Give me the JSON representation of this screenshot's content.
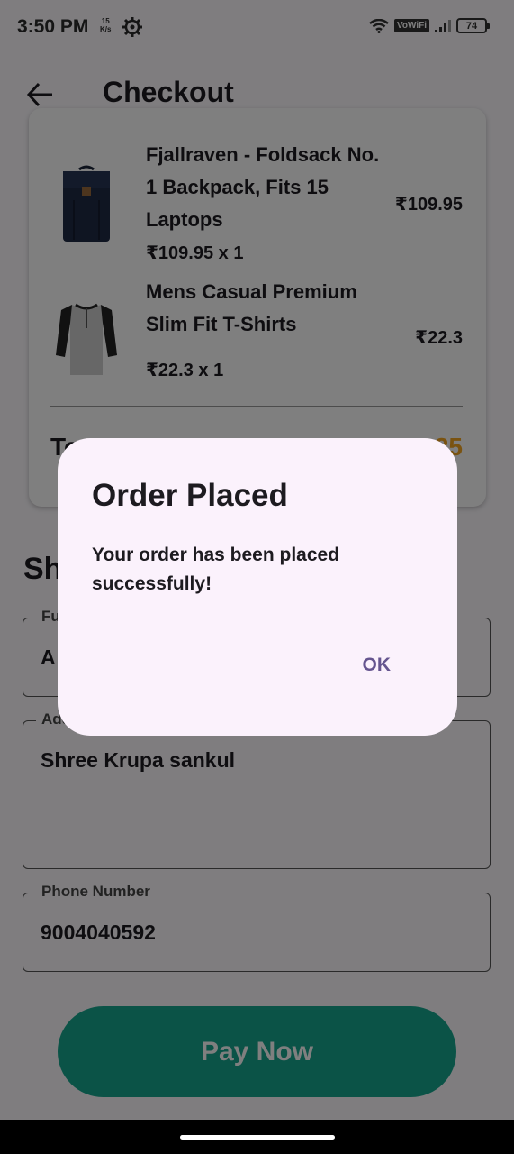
{
  "status_bar": {
    "time": "3:50 PM",
    "net_speed_value": "15",
    "net_speed_unit": "K/s",
    "vowifi": "VoWiFi",
    "battery": "74"
  },
  "app_bar": {
    "title": "Checkout"
  },
  "order_summary": {
    "items": [
      {
        "title": "Fjallraven - Foldsack No. 1 Backpack, Fits 15 Laptops",
        "qty_line": "₹109.95 x 1",
        "price": "₹109.95",
        "icon": "backpack-image"
      },
      {
        "title": "Mens Casual Premium Slim Fit T-Shirts",
        "qty_line": "₹22.3 x 1",
        "price": "₹22.3",
        "icon": "tshirt-image"
      }
    ],
    "total_label": "To",
    "total_value": "25"
  },
  "shipping": {
    "heading": "Sh",
    "full_name": {
      "label": "Fu",
      "value": "A"
    },
    "address": {
      "label": "Add",
      "value": "Shree Krupa sankul"
    },
    "phone": {
      "label": "Phone Number",
      "value": "9004040592"
    }
  },
  "pay_button": {
    "label": "Pay Now"
  },
  "dialog": {
    "title": "Order Placed",
    "message": "Your order has been placed successfully!",
    "ok_label": "OK"
  },
  "colors": {
    "accent_green": "#17a78f",
    "total_orange": "#f5a623",
    "dialog_bg": "#fbf2fc",
    "dialog_button": "#65558f"
  }
}
